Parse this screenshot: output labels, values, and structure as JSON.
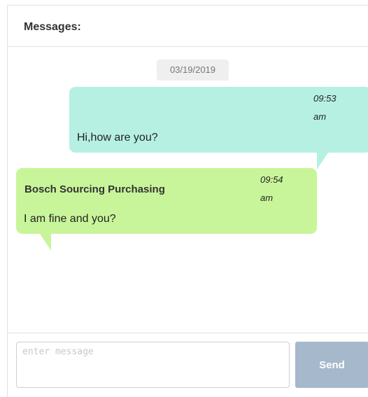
{
  "header": {
    "title": "Messages:"
  },
  "conversation": {
    "date": "03/19/2019",
    "messages": [
      {
        "direction": "outgoing",
        "time_hm": "09:53",
        "time_ampm": "am",
        "text": "Hi,how are you?",
        "bubble_color": "#b6f0e3"
      },
      {
        "direction": "incoming",
        "sender": "Bosch Sourcing Purchasing",
        "time_hm": "09:54",
        "time_ampm": "am",
        "text": "I am fine and you?",
        "bubble_color": "#c9f59a"
      }
    ]
  },
  "composer": {
    "placeholder": "enter message",
    "value": "",
    "send_label": "Send",
    "send_button_color": "#a6b8cb"
  }
}
